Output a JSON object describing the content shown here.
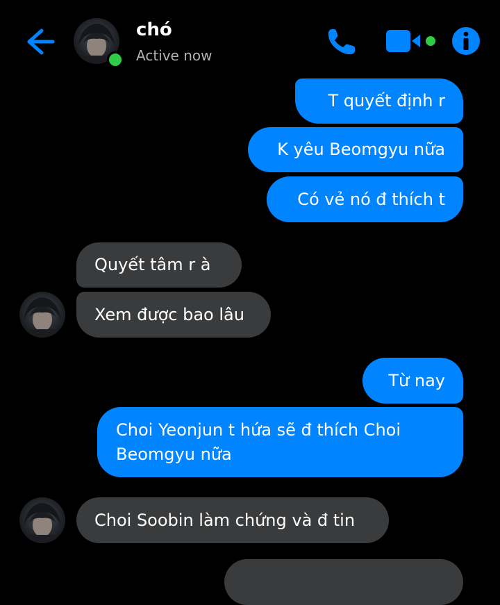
{
  "header": {
    "contact_name": "chó",
    "status": "Active now"
  },
  "colors": {
    "accent": "#0084ff",
    "online": "#31cc46",
    "incoming_bubble": "#3a3b3c",
    "background": "#000000"
  },
  "icons": {
    "back": "back-arrow-icon",
    "phone": "phone-icon",
    "video": "video-camera-icon",
    "info": "info-icon"
  },
  "messages": [
    {
      "from": "me",
      "text": "T quyết định r"
    },
    {
      "from": "me",
      "text": "K yêu Beomgyu nữa"
    },
    {
      "from": "me",
      "text": "Có vẻ nó đ thích t"
    },
    {
      "from": "them",
      "text": "Quyết tâm r à"
    },
    {
      "from": "them",
      "text": "Xem được bao lâu"
    },
    {
      "from": "me",
      "text": "Từ nay"
    },
    {
      "from": "me",
      "text": "Choi Yeonjun t hứa sẽ đ thích Choi Beomgyu nữa"
    },
    {
      "from": "them",
      "text": "Choi Soobin làm chứng và đ tin"
    }
  ]
}
